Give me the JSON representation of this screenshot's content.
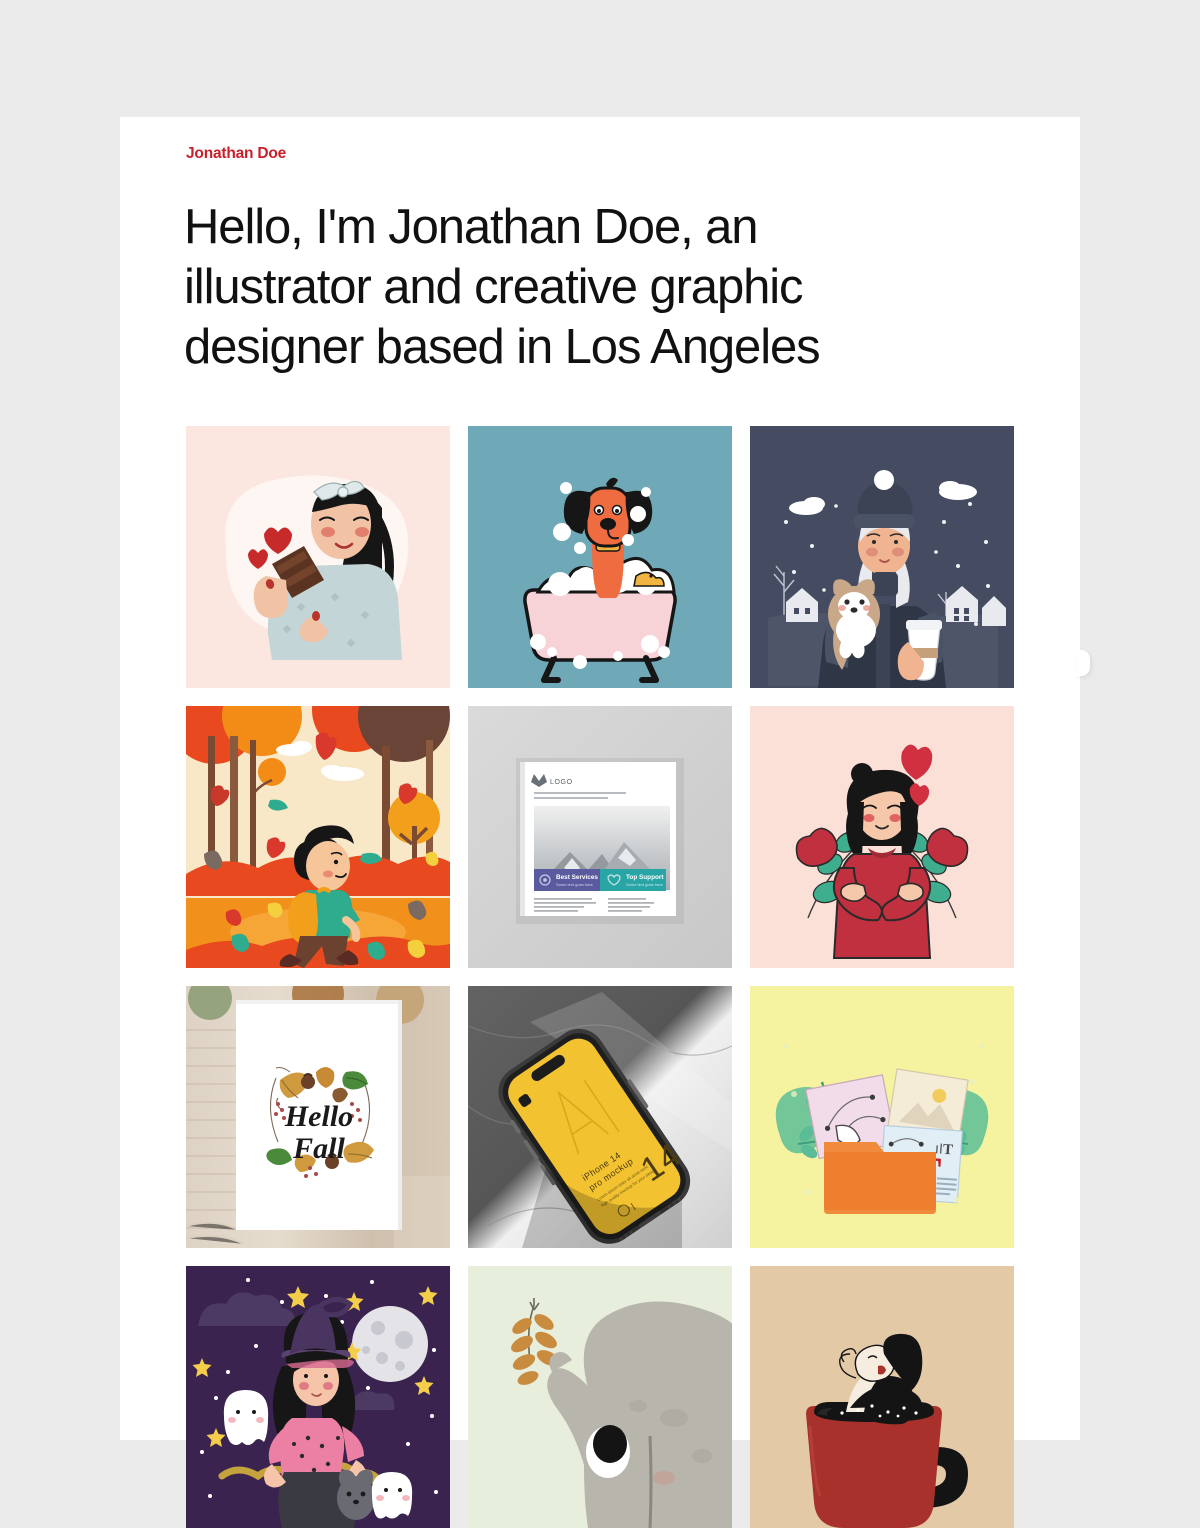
{
  "site": {
    "background_color": "#ebebeb",
    "card_color": "#ffffff",
    "accent_color": "#c8202a"
  },
  "header": {
    "brand": "Jonathan Doe",
    "heading": "Hello, I'm Jonathan Doe, an illustrator and creative graphic designer based in Los Angeles"
  },
  "gallery": {
    "columns": 3,
    "items": [
      {
        "id": 1,
        "title": "Girl eating chocolate with hearts",
        "category": "character-illustration",
        "bg": "#fbe7e0",
        "palette": [
          "#fbe7e0",
          "#fdf5f1",
          "#b9cdd0",
          "#1a1a1a",
          "#c0392b",
          "#5a3420"
        ]
      },
      {
        "id": 2,
        "title": "Dog taking a bubble bath",
        "category": "character-illustration",
        "bg": "#6fa8b7",
        "palette": [
          "#6fa8b7",
          "#f6cfd4",
          "#ffffff",
          "#ef6c41",
          "#1a1a1a",
          "#f4c33c"
        ]
      },
      {
        "id": 3,
        "title": "Winter girl holding puppy and coffee",
        "category": "character-illustration",
        "bg": "#454c61",
        "palette": [
          "#454c61",
          "#2f3647",
          "#ffffff",
          "#f0b89a",
          "#c49a72",
          "#e8e8e8"
        ]
      },
      {
        "id": 4,
        "title": "Boy walking in autumn forest",
        "category": "scene-illustration",
        "bg": "#f8e8c8",
        "palette": [
          "#f8e8c8",
          "#e8491f",
          "#f28c17",
          "#7a4b32",
          "#2fab8e",
          "#f5a623"
        ]
      },
      {
        "id": 5,
        "title": "Square brochure mockup",
        "category": "print-mockup",
        "bg": "#d4d4d4",
        "brochure": {
          "logo": "LOGO",
          "button_primary": "Best Services",
          "button_primary_sub": "Some text goes here",
          "button_secondary": "Top Support",
          "button_secondary_sub": "Some text goes here",
          "primary_color": "#5a5a9e",
          "secondary_color": "#2aa5a5"
        }
      },
      {
        "id": 6,
        "title": "Self love woman hugging herself",
        "category": "character-illustration",
        "bg": "#fbe0d8",
        "palette": [
          "#fbe0d8",
          "#c0303f",
          "#3fae8e",
          "#1a1a1a",
          "#d94b5a"
        ]
      },
      {
        "id": 7,
        "title": "Hello Fall poster print mockup",
        "category": "print-mockup",
        "bg": "#d8ccc0",
        "poster": {
          "line1": "Hello",
          "line2": "Fall"
        }
      },
      {
        "id": 8,
        "title": "iPhone 14 Pro mockup on marble",
        "category": "device-mockup",
        "bg": "#6b6b6b",
        "phone": {
          "screen_color": "#f2c230",
          "label": "iPhone 14 pro mockup",
          "number": "14"
        }
      },
      {
        "id": 9,
        "title": "Design folder with pen tool and typography",
        "category": "flat-illustration",
        "bg": "#f5f3a0",
        "palette": [
          "#f5f3a0",
          "#f08a3c",
          "#5bbd97",
          "#c0202a",
          "#dce9f2",
          "#f2dcea"
        ]
      },
      {
        "id": 10,
        "title": "Halloween witch flying with ghosts",
        "category": "scene-illustration",
        "bg": "#3b2350",
        "palette": [
          "#3b2350",
          "#4d3a63",
          "#e8e8e8",
          "#ec7fa4",
          "#f4cd4a",
          "#1a1a1a"
        ]
      },
      {
        "id": 11,
        "title": "Elephant holding a golden branch",
        "category": "nursery-illustration",
        "bg": "#e6ecdb",
        "palette": [
          "#e6ecdb",
          "#b5b2a9",
          "#c98c3e",
          "#1a1a1a",
          "#ffffff"
        ]
      },
      {
        "id": 12,
        "title": "Woman relaxing in a coffee cup",
        "category": "minimal-illustration",
        "bg": "#e3c9a5",
        "palette": [
          "#e3c9a5",
          "#a8312c",
          "#1a1a1a",
          "#f6ece0"
        ]
      }
    ]
  }
}
